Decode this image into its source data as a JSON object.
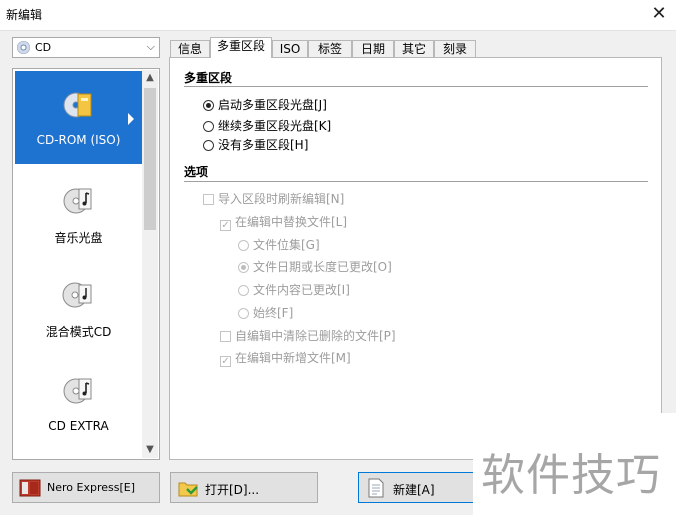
{
  "window": {
    "title": "新编辑",
    "close_glyph": "✕"
  },
  "disc_selector": {
    "value": "CD",
    "chevron": "⌵",
    "icon": "cd-disc-icon"
  },
  "disc_types": [
    {
      "label": "CD-ROM (ISO)",
      "icon": "cd-rom-iso-icon",
      "selected": true
    },
    {
      "label": "音乐光盘",
      "icon": "music-disc-icon",
      "selected": false
    },
    {
      "label": "混合模式CD",
      "icon": "mixed-mode-cd-icon",
      "selected": false
    },
    {
      "label": "CD EXTRA",
      "icon": "cd-extra-icon",
      "selected": false
    }
  ],
  "tabs": [
    "信息",
    "多重区段",
    "ISO",
    "标签",
    "日期",
    "其它",
    "刻录"
  ],
  "active_tab": "多重区段",
  "multisession": {
    "heading": "多重区段",
    "options": [
      {
        "label": "启动多重区段光盘[J]",
        "checked": true
      },
      {
        "label": "继续多重区段光盘[K]",
        "checked": false
      },
      {
        "label": "没有多重区段[H]",
        "checked": false
      }
    ]
  },
  "options_section": {
    "heading": "选项",
    "refresh_on_import": "导入区段时刷新编辑[N]",
    "replace_files": "在编辑中替换文件[L]",
    "replace_modes": [
      {
        "label": "文件位集[G]",
        "checked": false
      },
      {
        "label": "文件日期或长度已更改[O]",
        "checked": true
      },
      {
        "label": "文件内容已更改[I]",
        "checked": false
      },
      {
        "label": "始终[F]",
        "checked": false
      }
    ],
    "remove_deleted": "自编辑中清除已删除的文件[P]",
    "add_new": "在编辑中新增文件[M]"
  },
  "buttons": {
    "nero_express": "Nero Express[E]",
    "open": "打开[D]...",
    "new": "新建[A]"
  },
  "watermark": "软件技巧",
  "colors": {
    "selection": "#1e73d1",
    "disabled_text": "#9d9d9d"
  }
}
